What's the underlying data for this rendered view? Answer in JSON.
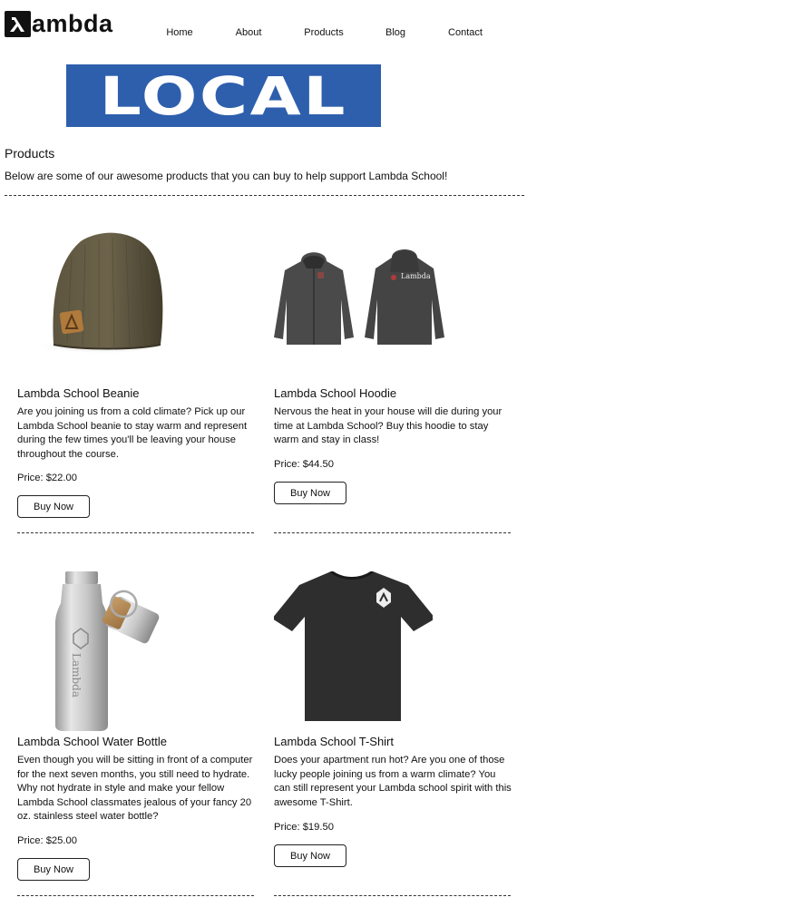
{
  "header": {
    "logo_text": "ambda",
    "logo_icon": "lambda-icon",
    "nav": [
      "Home",
      "About",
      "Products",
      "Blog",
      "Contact"
    ]
  },
  "banner": {
    "text": "LOCAL",
    "color": "#2e5fad"
  },
  "products_section": {
    "title": "Products",
    "description": "Below are some of our awesome products that you can buy to help support Lambda School!"
  },
  "products": [
    {
      "name": "Lambda School Beanie",
      "image_icon": "beanie-image",
      "description": "Are you joining us from a cold climate? Pick up our Lambda School beanie to stay warm and represent during the few times you'll be leaving your house throughout the course.",
      "price": "Price: $22.00",
      "button": "Buy Now"
    },
    {
      "name": "Lambda School Hoodie",
      "image_icon": "hoodie-image",
      "description": "Nervous the heat in your house will die during your time at Lambda School? Buy this hoodie to stay warm and stay in class!",
      "price": "Price: $44.50",
      "button": "Buy Now",
      "image_label": "Lambda"
    },
    {
      "name": "Lambda School Water Bottle",
      "image_icon": "water-bottle-image",
      "description": "Even though you will be sitting in front of a computer for the next seven months, you still need to hydrate. Why not hydrate in style and make your fellow Lambda School classmates jealous of your fancy 20 oz. stainless steel water bottle?",
      "price": "Price: $25.00",
      "button": "Buy Now",
      "image_label": "Lambda"
    },
    {
      "name": "Lambda School T-Shirt",
      "image_icon": "t-shirt-image",
      "description": "Does your apartment run hot? Are you one of those lucky people joining us from a warm climate? You can still represent your Lambda school spirit with this awesome T-Shirt.",
      "price": "Price: $19.50",
      "button": "Buy Now"
    }
  ]
}
